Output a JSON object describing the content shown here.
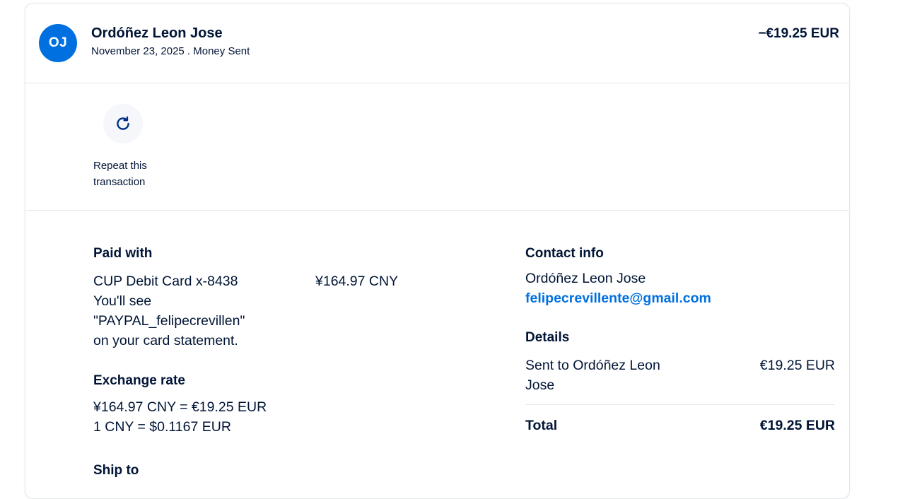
{
  "header": {
    "avatar_initials": "OJ",
    "name": "Ordóñez Leon Jose",
    "subline": "November 23, 2025 . Money Sent",
    "amount": "−€19.25 EUR"
  },
  "actions": {
    "repeat_line1": "Repeat this",
    "repeat_line2": "transaction"
  },
  "paid_with": {
    "heading": "Paid with",
    "card": "CUP Debit Card x-8438",
    "card_amount": "¥164.97 CNY",
    "line2": "You'll see",
    "line3": "\"PAYPAL_felipecrevillen\"",
    "line4": "on your card statement."
  },
  "exchange": {
    "heading": "Exchange rate",
    "line1": "¥164.97 CNY = €19.25 EUR",
    "line2": "1 CNY = $0.1167 EUR"
  },
  "ship_to": {
    "heading": "Ship to"
  },
  "contact": {
    "heading": "Contact info",
    "name": "Ordóñez Leon Jose",
    "email": "felipecrevillente@gmail.com"
  },
  "details": {
    "heading": "Details",
    "sent_to_line1": "Sent to Ordóñez Leon",
    "sent_to_line2": "Jose",
    "sent_amount": "€19.25 EUR",
    "total_label": "Total",
    "total_amount": "€19.25 EUR"
  },
  "colors": {
    "accent": "#0070e0",
    "text": "#001435",
    "divider": "#e5e7eb"
  }
}
